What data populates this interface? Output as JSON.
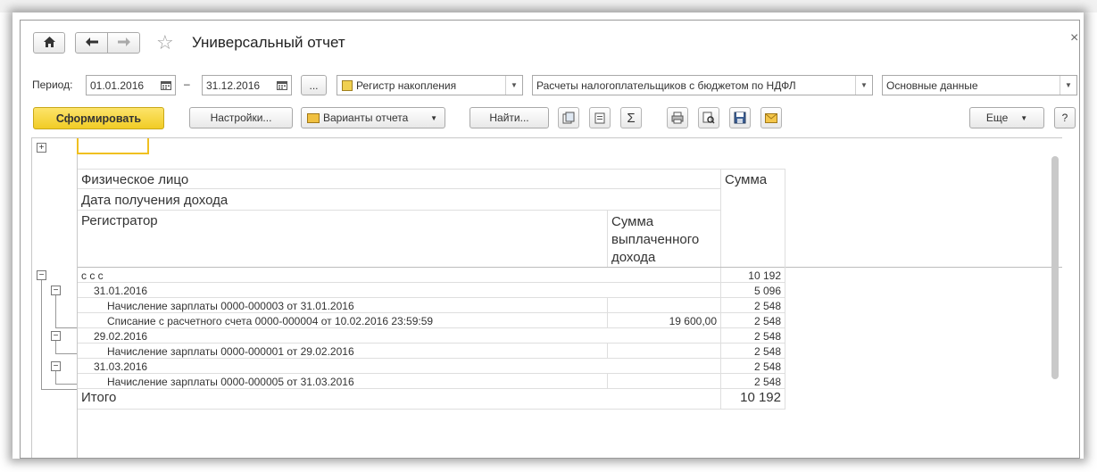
{
  "window": {
    "title": "Универсальный отчет",
    "close_glyph": "×"
  },
  "toolbar": {
    "home_icon": "home-icon",
    "back_icon": "arrow-left-icon",
    "forward_icon": "arrow-right-icon",
    "favorite_icon": "star-icon"
  },
  "period": {
    "label": "Период:",
    "start": "01.01.2016",
    "dash": "–",
    "end": "31.12.2016",
    "ellipsis": "..."
  },
  "selectors": {
    "register_type": "Регистр накопления",
    "register_name": "Расчеты налогоплательщиков с бюджетом по НДФЛ",
    "data_set": "Основные данные"
  },
  "actions": {
    "generate": "Сформировать",
    "settings": "Настройки...",
    "variants": "Варианты отчета",
    "find": "Найти...",
    "more": "Еще",
    "help": "?"
  },
  "colors": {
    "accent": "#f5d33b",
    "accent_border": "#c9a818"
  },
  "report": {
    "headers": {
      "person": "Физическое лицо",
      "income_date": "Дата получения дохода",
      "registrar": "Регистратор",
      "paid_income": "Сумма выплаченного дохода",
      "sum": "Сумма"
    },
    "rows": [
      {
        "label": "с с с",
        "paid": "",
        "sum": "10 192"
      },
      {
        "label": "31.01.2016",
        "paid": "",
        "sum": "5 096"
      },
      {
        "label": "Начисление зарплаты 0000-000003 от 31.01.2016",
        "paid": "",
        "sum": "2 548"
      },
      {
        "label": "Списание с расчетного счета 0000-000004 от 10.02.2016 23:59:59",
        "paid": "19 600,00",
        "sum": "2 548"
      },
      {
        "label": "29.02.2016",
        "paid": "",
        "sum": "2 548"
      },
      {
        "label": "Начисление зарплаты 0000-000001 от 29.02.2016",
        "paid": "",
        "sum": "2 548"
      },
      {
        "label": "31.03.2016",
        "paid": "",
        "sum": "2 548"
      },
      {
        "label": "Начисление зарплаты 0000-000005 от 31.03.2016",
        "paid": "",
        "sum": "2 548"
      }
    ],
    "total_label": "Итого",
    "total_sum": "10 192"
  }
}
